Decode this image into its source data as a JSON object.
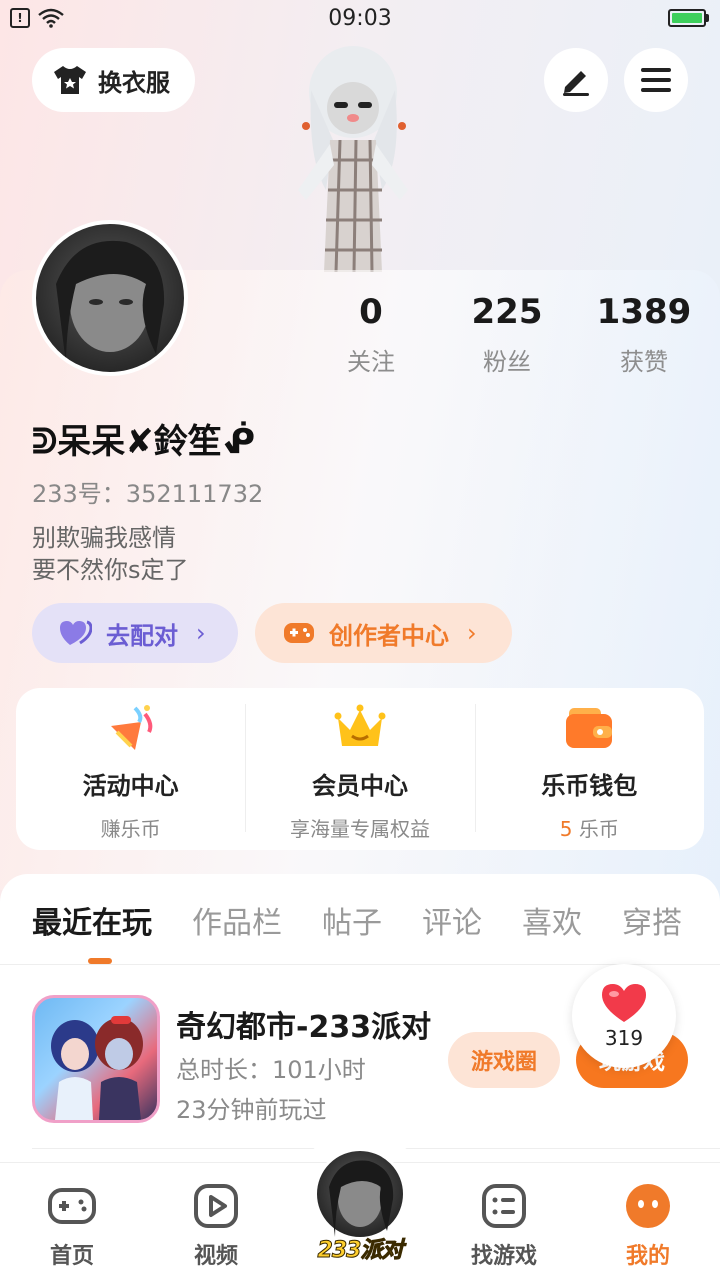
{
  "status_bar": {
    "time": "09:03"
  },
  "top_bar": {
    "outfit_label": "换衣服"
  },
  "profile": {
    "stats": [
      {
        "value": "0",
        "label": "关注"
      },
      {
        "value": "225",
        "label": "粉丝"
      },
      {
        "value": "1389",
        "label": "获赞"
      }
    ],
    "nickname": "ᕲ呆呆✘鈴笙ᕶ",
    "id_text": "233号：352111732",
    "bio_line1": "别欺骗我感情",
    "bio_line2": "要不然你s定了",
    "match_label": "去配对",
    "creator_label": "创作者中心"
  },
  "features": [
    {
      "title": "活动中心",
      "subtitle": "赚乐币",
      "icon": "party-popper-icon"
    },
    {
      "title": "会员中心",
      "subtitle": "享海量专属权益",
      "icon": "crown-icon"
    },
    {
      "title": "乐币钱包",
      "coin_count": "5",
      "coin_unit": "乐币",
      "icon": "wallet-icon"
    }
  ],
  "tabs": [
    "最近在玩",
    "作品栏",
    "帖子",
    "评论",
    "喜欢",
    "穿搭"
  ],
  "game": {
    "title": "奇幻都市-233派对",
    "duration": "总时长：101小时",
    "last_played": "23分钟前玩过",
    "circle_label": "游戏圈",
    "play_label": "玩游戏",
    "like_count": "319"
  },
  "bottom_nav": {
    "items": [
      {
        "label": "首页",
        "icon": "gamepad-icon"
      },
      {
        "label": "视频",
        "icon": "video-icon"
      },
      {
        "label": "找游戏",
        "icon": "list-icon"
      },
      {
        "label": "我的",
        "icon": "me-icon"
      }
    ],
    "center_label": "233派对"
  },
  "colors": {
    "accent": "#f07a2a",
    "match": "#6b5dd3"
  }
}
